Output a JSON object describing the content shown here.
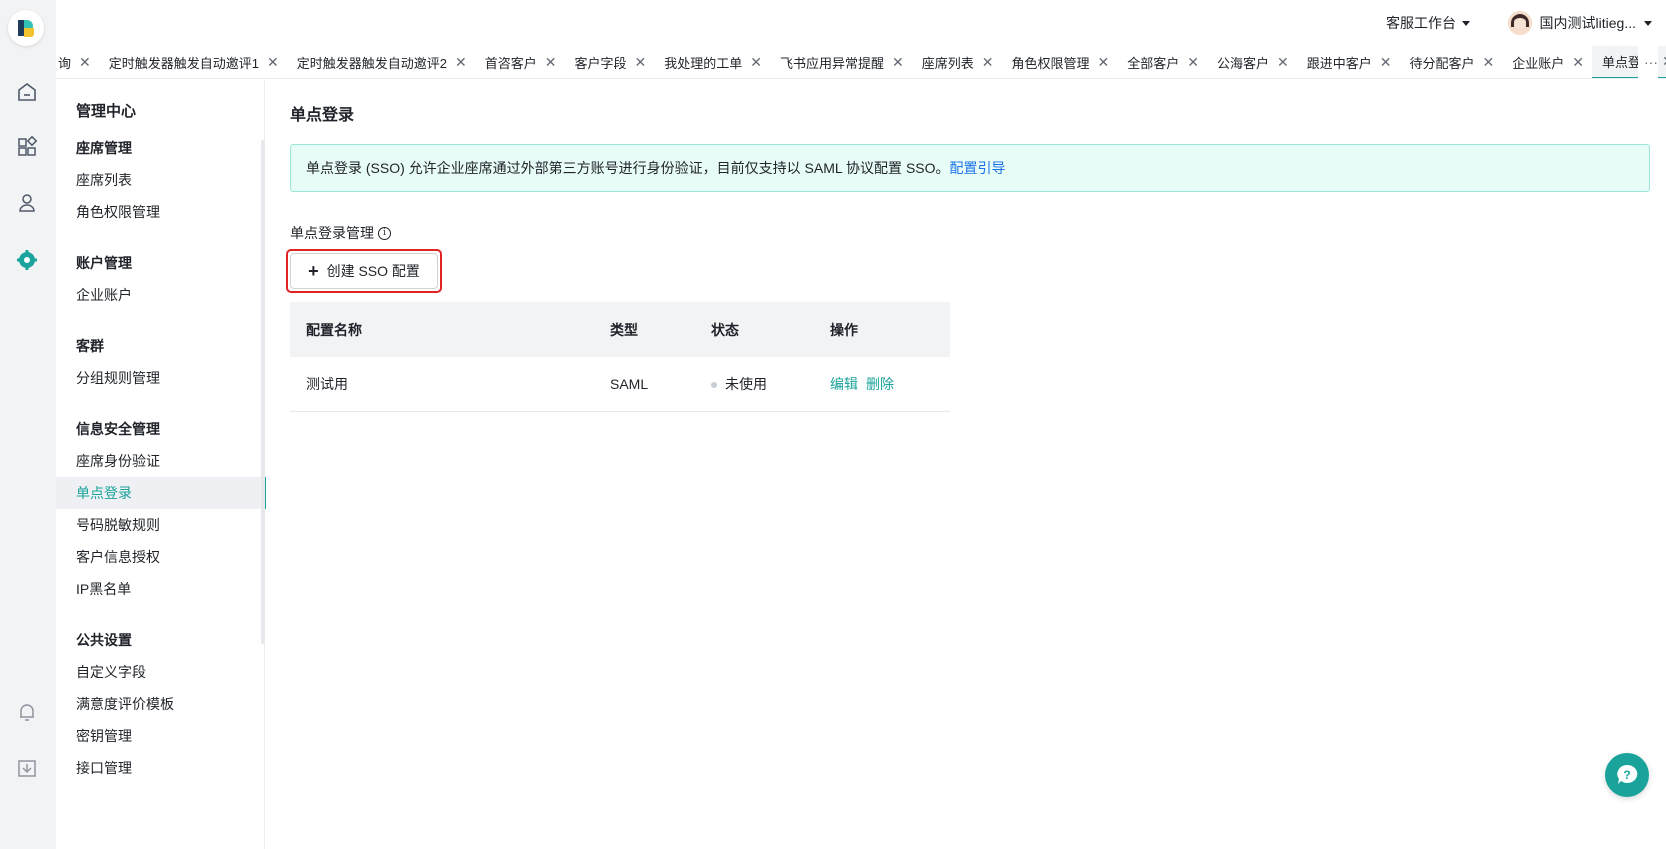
{
  "topbar": {
    "workspace": "客服工作台",
    "user_name": "国内测试litieg..."
  },
  "tabs": [
    {
      "label": "询",
      "active": false
    },
    {
      "label": "定时触发器触发自动邀评1",
      "active": false
    },
    {
      "label": "定时触发器触发自动邀评2",
      "active": false
    },
    {
      "label": "首咨客户",
      "active": false
    },
    {
      "label": "客户字段",
      "active": false
    },
    {
      "label": "我处理的工单",
      "active": false
    },
    {
      "label": "飞书应用异常提醒",
      "active": false
    },
    {
      "label": "座席列表",
      "active": false
    },
    {
      "label": "角色权限管理",
      "active": false
    },
    {
      "label": "全部客户",
      "active": false
    },
    {
      "label": "公海客户",
      "active": false
    },
    {
      "label": "跟进中客户",
      "active": false
    },
    {
      "label": "待分配客户",
      "active": false
    },
    {
      "label": "企业账户",
      "active": false
    },
    {
      "label": "单点登录",
      "active": true
    }
  ],
  "tabs_more": "···",
  "sidemenu": {
    "title": "管理中心",
    "sections": [
      {
        "title": "座席管理",
        "items": [
          "座席列表",
          "角色权限管理"
        ]
      },
      {
        "title": "账户管理",
        "items": [
          "企业账户"
        ]
      },
      {
        "title": "客群",
        "items": [
          "分组规则管理"
        ]
      },
      {
        "title": "信息安全管理",
        "items": [
          "座席身份验证",
          "单点登录",
          "号码脱敏规则",
          "客户信息授权",
          "IP黑名单"
        ]
      },
      {
        "title": "公共设置",
        "items": [
          "自定义字段",
          "满意度评价模板",
          "密钥管理",
          "接口管理"
        ]
      }
    ],
    "active_item": "单点登录"
  },
  "main": {
    "title": "单点登录",
    "alert_text": "单点登录 (SSO) 允许企业座席通过外部第三方账号进行身份验证，目前仅支持以 SAML 协议配置 SSO。",
    "alert_link": "配置引导",
    "section_label": "单点登录管理",
    "create_button": "创建 SSO 配置",
    "table": {
      "headers": [
        "配置名称",
        "类型",
        "状态",
        "操作"
      ],
      "rows": [
        {
          "name": "测试用",
          "type": "SAML",
          "status": "未使用",
          "actions": [
            "编辑",
            "删除"
          ]
        }
      ]
    }
  },
  "colors": {
    "accent": "#1aa39a",
    "highlight_border": "#e02424",
    "alert_bg": "#e7fbf7",
    "link_blue": "#1a73e8"
  }
}
